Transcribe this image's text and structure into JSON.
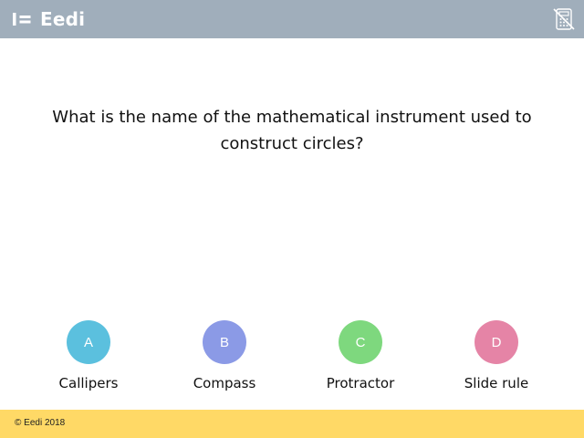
{
  "header": {
    "brand": "Eedi",
    "logo_icon": "eedi-logo-icon",
    "calculator_icon": "calculator-not-allowed-icon",
    "background_color": "#a0aebb"
  },
  "question": {
    "text": "What is the name of the mathematical instrument used to construct circles?"
  },
  "options": [
    {
      "letter": "A",
      "label": "Callipers",
      "color": "#5bc0de"
    },
    {
      "letter": "B",
      "label": "Compass",
      "color": "#8b9ae6"
    },
    {
      "letter": "C",
      "label": "Protractor",
      "color": "#7ed87e"
    },
    {
      "letter": "D",
      "label": "Slide rule",
      "color": "#e584a6"
    }
  ],
  "footer": {
    "copyright": "© Eedi 2018",
    "background_color": "#ffd966"
  }
}
